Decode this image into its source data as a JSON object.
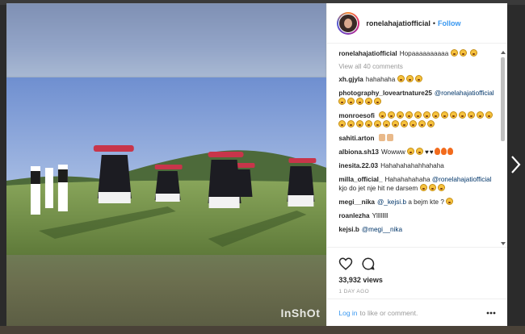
{
  "header": {
    "username": "ronelahajatiofficial",
    "separator": "•",
    "follow_label": "Follow"
  },
  "video": {
    "watermark": "InShOt"
  },
  "caption": {
    "username": "ronelahajatiofficial",
    "text": "Hopaaaaaaaaaa"
  },
  "view_all_comments": "View all 40 comments",
  "comments": [
    {
      "username": "xh.gjyla",
      "text": "hahahaha"
    },
    {
      "username": "photography_loveartnature25",
      "mention": "@ronelahajatiofficial",
      "text": ""
    },
    {
      "username": "monroesofi",
      "text": ""
    },
    {
      "username": "sahiti.arton",
      "text": ""
    },
    {
      "username": "albiona.sh13",
      "text": "Wowww"
    },
    {
      "username": "inesita.22.03",
      "text": "Hahahahahahhahaha"
    },
    {
      "username": "milla_official_",
      "text": "Hahahahahaha",
      "mention": "@ronelahajatiofficial",
      "text2": "kjo do jet nje hit ne darsem"
    },
    {
      "username": "megi__nika",
      "mention": "@_kejsi.b",
      "text": "a bejm kte ?"
    },
    {
      "username": "roanlezha",
      "text": "Yllllllll"
    },
    {
      "username": "kejsi.b",
      "mention": "@megi__nika",
      "text": ""
    }
  ],
  "actions": {
    "like_icon": "heart-outline-icon",
    "comment_icon": "comment-bubble-icon"
  },
  "views": "33,932 views",
  "time_ago": "1 DAY AGO",
  "footer": {
    "login_label": "Log in",
    "suffix": "to like or comment.",
    "more_icon": "more-options-icon"
  },
  "colors": {
    "link": "#3897f0",
    "text": "#262626",
    "muted": "#999999"
  }
}
